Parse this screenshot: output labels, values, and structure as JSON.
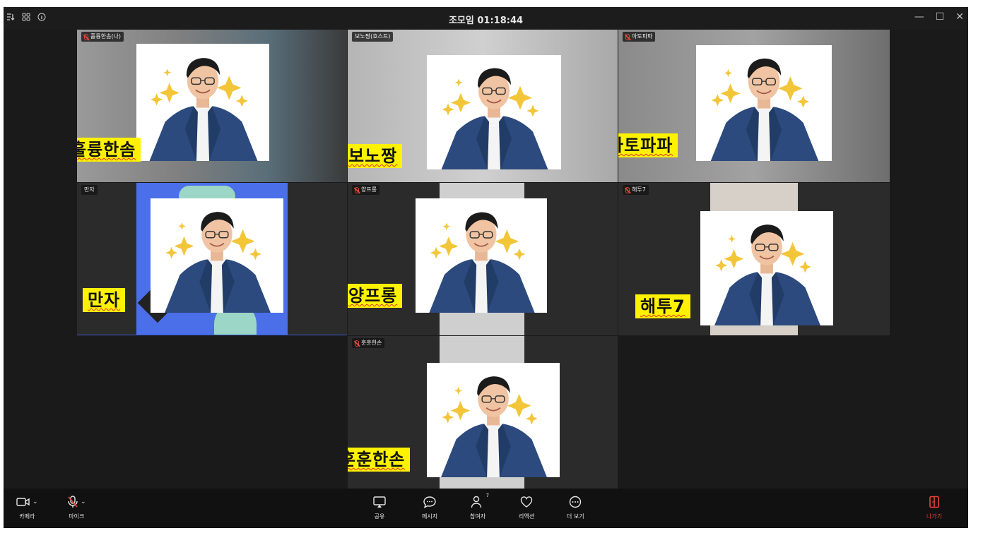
{
  "titlebar": {
    "title": "조모임 01:18:44",
    "icons": [
      "sort-icon",
      "grid-icon",
      "info-icon"
    ],
    "window_controls": [
      "—",
      "☐",
      "✕"
    ]
  },
  "tiles": [
    {
      "id": "t1",
      "badge": "훌륭한솜(나)",
      "mic_muted": true,
      "nameplate": "훌륭한솜",
      "bg": "#6f6f6f"
    },
    {
      "id": "t2",
      "badge": "보노짱(호스트)",
      "mic_muted": false,
      "nameplate": "보노짱",
      "bg": "#8a8a8a"
    },
    {
      "id": "t3",
      "badge": "아토파파",
      "mic_muted": true,
      "nameplate": "아토파파",
      "bg": "#7a7a7a"
    },
    {
      "id": "t4",
      "badge": "만자",
      "mic_muted": false,
      "nameplate": "만자",
      "bg": "#2b2b2b"
    },
    {
      "id": "t5",
      "badge": "양프롱",
      "mic_muted": true,
      "nameplate": "양프롱",
      "bg": "#2b2b2b"
    },
    {
      "id": "t6",
      "badge": "해투7",
      "mic_muted": true,
      "nameplate": "해투7",
      "bg": "#2b2b2b"
    },
    {
      "id": "t7",
      "badge": "훈훈한손",
      "mic_muted": true,
      "nameplate": "훈훈한손",
      "bg": "#2b2b2b"
    }
  ],
  "toolbar": {
    "camera_label": "카메라",
    "mic_label": "마이크",
    "share_label": "공유",
    "message_label": "메시지",
    "participants_label": "참여자",
    "participants_count": "7",
    "reaction_label": "리액션",
    "more_label": "더 보기",
    "leave_label": "나가기"
  },
  "colors": {
    "nameplate_bg": "#fff200",
    "leave_accent": "#e8433a",
    "muted_mic": "#e0443a",
    "active_speaker_border": "#3a5bd9"
  }
}
